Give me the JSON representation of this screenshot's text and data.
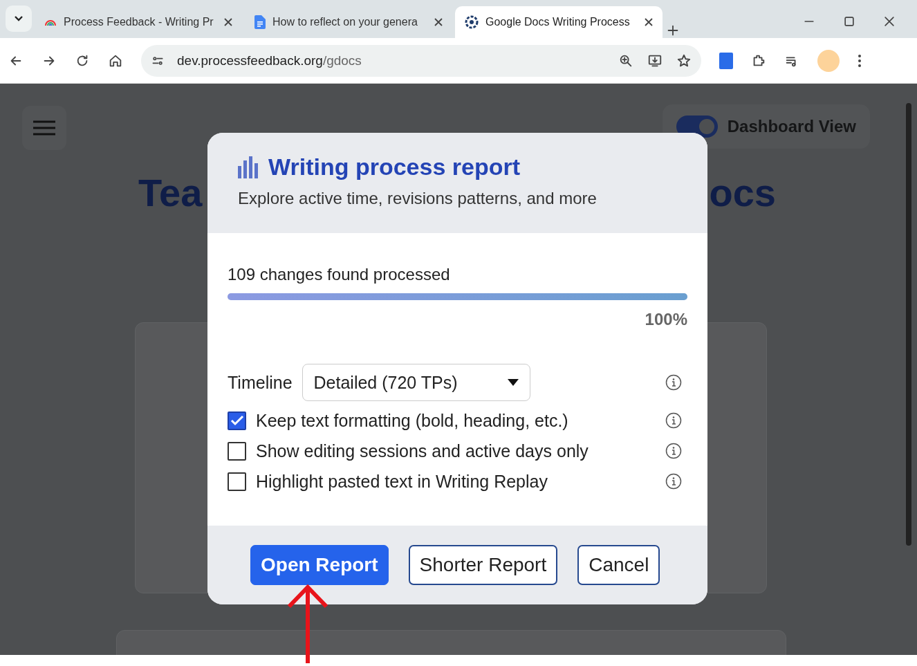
{
  "browser": {
    "tabs": [
      {
        "title": "Process Feedback - Writing Pr",
        "selected": false
      },
      {
        "title": "How to reflect on your genera",
        "selected": false
      },
      {
        "title": "Google Docs Writing Process",
        "selected": true
      }
    ],
    "address_host": "dev.processfeedback.org",
    "address_path": "/gdocs"
  },
  "page": {
    "heading_left": "Tea",
    "heading_right": "ocs",
    "toggle": {
      "label": "Dashboard View",
      "on": true
    }
  },
  "dialog": {
    "title": "Writing process report",
    "subtitle": "Explore active time, revisions patterns, and more",
    "progress": {
      "label": "109 changes found processed",
      "level": 1,
      "reading": "100%"
    },
    "timeline": {
      "label": "Timeline",
      "value": "Detailed (720 TPs)"
    },
    "options": [
      {
        "label": "Keep text formatting (bold, heading, etc.)",
        "checked": true
      },
      {
        "label": "Show editing sessions and active days only",
        "checked": false
      },
      {
        "label": "Highlight pasted text in Writing Replay",
        "checked": false
      }
    ],
    "buttons": [
      {
        "label": "Open Report",
        "kind": "primary"
      },
      {
        "label": "Shorter Report",
        "kind": "outline"
      },
      {
        "label": "Cancel",
        "kind": "outline"
      }
    ]
  }
}
